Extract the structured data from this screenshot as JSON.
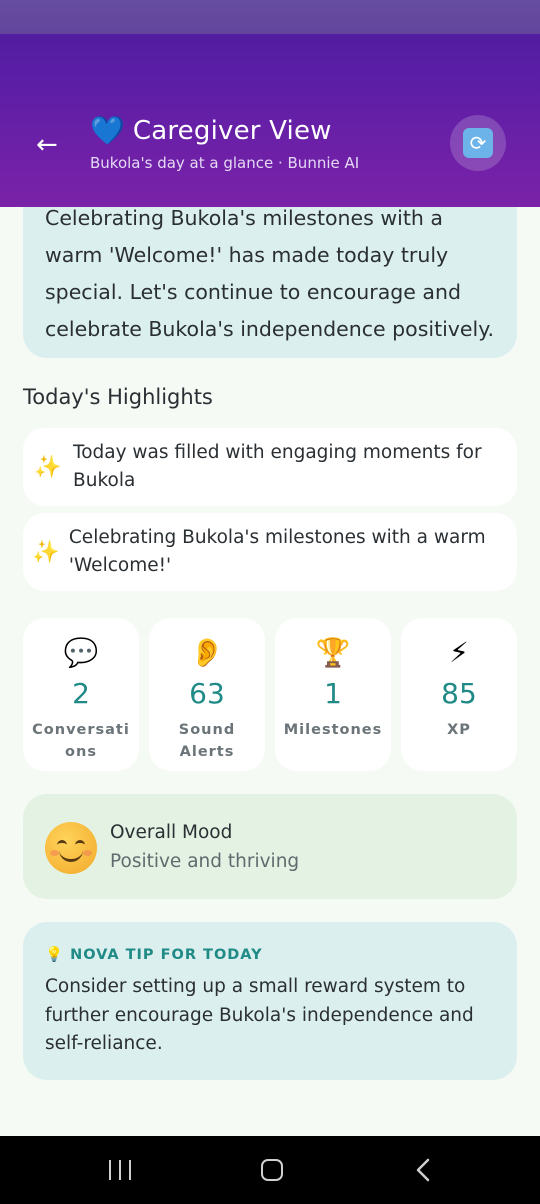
{
  "header": {
    "title": "Caregiver View",
    "subtitle": "Bukola's day at a glance · Bunnie AI",
    "back_icon": "←",
    "heart_icon": "💙",
    "refresh_icon": "🔄"
  },
  "summary": {
    "lines": [
      "Celebrating Bukola's milestones with a",
      "warm 'Welcome!' has made today truly",
      "special. Let's continue to encourage and",
      "celebrate Bukola's independence positively."
    ]
  },
  "highlights": {
    "title": "Today's Highlights",
    "icon": "✨",
    "items": [
      "Today was filled with engaging moments for Bukola",
      "Celebrating Bukola's milestones with a warm 'Welcome!'"
    ]
  },
  "stats": [
    {
      "icon": "💬",
      "value": "2",
      "label": "Conversati ons"
    },
    {
      "icon": "👂",
      "value": "63",
      "label": "Sound Alerts"
    },
    {
      "icon": "🏆",
      "value": "1",
      "label": "Milestones"
    },
    {
      "icon": "⚡",
      "value": "85",
      "label": "XP"
    }
  ],
  "mood": {
    "title": "Overall Mood",
    "value": "Positive and thriving"
  },
  "tip": {
    "icon": "💡",
    "heading": "NOVA TIP FOR TODAY",
    "body": "Consider setting up a small reward system to further encourage Bukola's independence and self-reliance."
  },
  "colors": {
    "accent": "#1f8a86",
    "header_top": "#4a1c9a",
    "header_bottom": "#7a22a8"
  }
}
